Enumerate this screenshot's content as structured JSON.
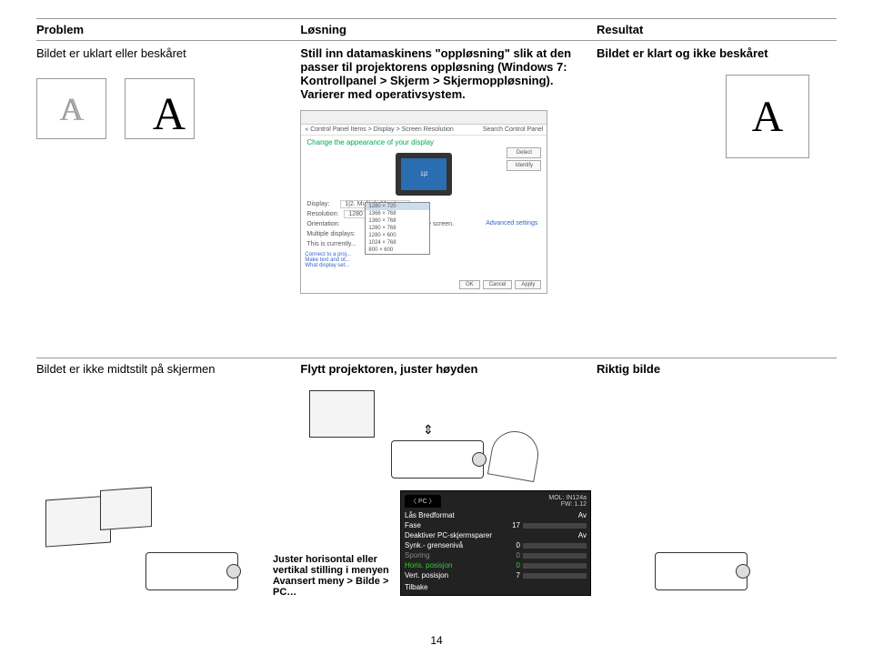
{
  "headers": {
    "col1": "Problem",
    "col2": "Løsning",
    "col3": "Resultat"
  },
  "row1": {
    "problem": "Bildet er uklart eller beskåret",
    "solution": "Still inn datamaskinens \"oppløsning\" slik at den passer til projektorens oppløsning (Windows 7: Kontrollpanel > Skjerm > Skjermoppløsning). Varierer med operativsystem.",
    "result": "Bildet er klart og ikke beskåret",
    "letter": "A",
    "win": {
      "title": "Change the appearance of your display",
      "breadcrumb": "« Control Panel Items > Display > Screen Resolution",
      "search": "Search Control Panel",
      "btn_detect": "Detect",
      "btn_identify": "Identify",
      "display_label": "Display:",
      "display_value": "1|2. Multiple Monitors",
      "resolution_label": "Resolution:",
      "resolution_value": "1280 × 720",
      "orientation_label": "Orientation:",
      "multiple_label": "Multiple displays:",
      "currently": "This is currently...",
      "fit": "not fit on the screen.",
      "options": [
        "1280 × 720",
        "1366 × 768",
        "1360 × 768",
        "1280 × 768",
        "1280 × 600",
        "1024 × 768",
        "800 × 600"
      ],
      "advanced": "Advanced settings",
      "side_links": [
        "Connect to a proj...",
        "Make text and ot...",
        "What display set..."
      ],
      "ok": "OK",
      "cancel": "Cancel",
      "apply": "Apply"
    }
  },
  "row2": {
    "problem": "Bildet er ikke midtstilt på skjermen",
    "solution": "Flytt projektoren, juster høyden",
    "result": "Riktig bilde",
    "adjust_text": "Juster horisontal eller vertikal stilling i menyen Avansert meny > Bilde > PC…",
    "osd": {
      "tab": "PC",
      "mol": "MOL: IN124a",
      "fw": "FW: 1.12",
      "items": [
        {
          "label": "Lås Bredformat",
          "value": "Av"
        },
        {
          "label": "Fase",
          "value": "17",
          "slider": 40
        },
        {
          "label": "Deaktiver PC-skjermsparer",
          "value": "Av"
        },
        {
          "label": "Synk.- grensenivå",
          "value": "0",
          "slider": 0
        },
        {
          "label": "Sporing",
          "value": "0",
          "slider": 0
        },
        {
          "label": "Horis. posisjon",
          "value": "0",
          "slider": 10,
          "green": true
        },
        {
          "label": "Vert. posisjon",
          "value": "7",
          "slider": 20
        }
      ],
      "back": "Tilbake"
    }
  },
  "page": "14"
}
